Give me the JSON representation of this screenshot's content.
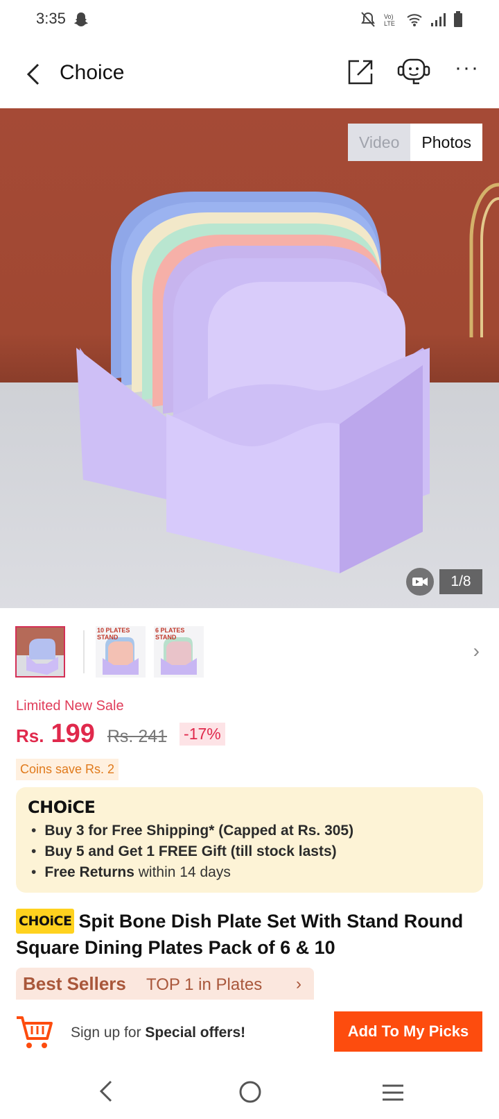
{
  "status_bar": {
    "time": "3:35",
    "icons": [
      "snapchat-icon",
      "mute-icon",
      "volte-icon",
      "wifi-icon",
      "signal-icon",
      "battery-icon"
    ]
  },
  "header": {
    "title": "Choice",
    "icons": [
      "back-icon",
      "share-icon",
      "support-icon",
      "more-icon"
    ]
  },
  "gallery": {
    "tabs": [
      {
        "label": "Video",
        "active": false
      },
      {
        "label": "Photos",
        "active": true
      }
    ],
    "counter": "1/8",
    "thumbnails": [
      {
        "label": "",
        "selected": true
      },
      {
        "label": "10 PLATES STAND",
        "selected": false
      },
      {
        "label": "6 PLATES STAND",
        "selected": false
      }
    ]
  },
  "pricing": {
    "sale_label": "Limited New Sale",
    "currency": "Rs.",
    "price": "199",
    "original_price": "Rs. 241",
    "discount": "-17%",
    "coins": "Coins save Rs. 2"
  },
  "choice_box": {
    "logo": "CHOiCE",
    "bullets": [
      {
        "bold": "Buy 3 for  Free Shipping* (Capped at Rs. 305)",
        "rest": ""
      },
      {
        "bold": "Buy 5 and Get 1 FREE Gift (till stock lasts)",
        "rest": ""
      },
      {
        "bold": "Free Returns",
        "rest": " within 14 days"
      }
    ]
  },
  "product": {
    "badge": "CHOiCE",
    "title": "Spit Bone Dish Plate Set With Stand Round Square Dining Plates Pack of 6 & 10"
  },
  "best_sellers": {
    "label": "Best Sellers",
    "rank": "TOP 1 in Plates",
    "arrow": "›"
  },
  "bottom_bar": {
    "signup_prefix": "Sign up for ",
    "signup_bold": "Special offers!",
    "cta": "Add To My Picks"
  },
  "colors": {
    "accent": "#fd4c0e",
    "price": "#e0294c",
    "choice_bg": "#fdf3d6",
    "choice_badge": "#ffd21e"
  }
}
